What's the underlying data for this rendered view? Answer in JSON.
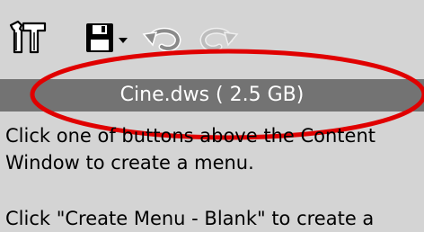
{
  "toolbar": {
    "tools_icon": "tools-icon",
    "save_icon": "save-icon",
    "dropdown_icon": "dropdown-arrow-icon",
    "undo_icon": "undo-icon",
    "redo_icon": "redo-icon"
  },
  "file_bar": {
    "label": "Cine.dws ( 2.5 GB)"
  },
  "info": {
    "paragraph1": "Click one of buttons above the Content Window to create a menu.",
    "paragraph2": "Click \"Create Menu - Blank\" to create a"
  },
  "colors": {
    "background": "#d4d4d4",
    "file_bar": "#737373",
    "highlight_ellipse": "#e00000"
  }
}
